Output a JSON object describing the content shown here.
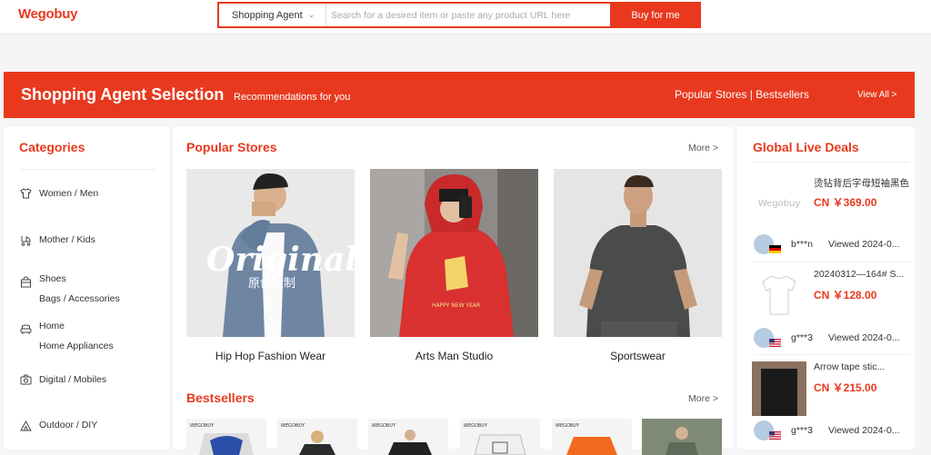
{
  "header": {
    "logo_text": "Wegobuy",
    "search": {
      "type_label": "Shopping Agent",
      "placeholder": "Search for a desired item or paste any product URL here",
      "button_label": "Buy for me"
    }
  },
  "banner": {
    "title": "Shopping Agent Selection",
    "subtitle": "Recommendations for you",
    "right_text": "Popular Stores | Bestsellers",
    "view_all": "View All >"
  },
  "categories": {
    "title": "Categories",
    "items": [
      {
        "lines": [
          "Women / Men"
        ],
        "icon": "shirt-icon"
      },
      {
        "lines": [
          "Mother / Kids"
        ],
        "icon": "stroller-icon"
      },
      {
        "lines": [
          "Shoes",
          "Bags / Accessories"
        ],
        "icon": "bag-icon"
      },
      {
        "lines": [
          "Home",
          "Home Appliances"
        ],
        "icon": "sofa-icon"
      },
      {
        "lines": [
          "Digital / Mobiles"
        ],
        "icon": "camera-icon"
      },
      {
        "lines": [
          "Outdoor / DIY"
        ],
        "icon": "tent-icon"
      }
    ]
  },
  "popular_stores": {
    "title": "Popular Stores",
    "more": "More >",
    "stores": [
      {
        "name": "Hip Hop Fashion Wear",
        "overlay": "Original",
        "overlay_sub": "原创定制"
      },
      {
        "name": "Arts Man Studio",
        "overlay": "HAPPY NEW YEAR"
      },
      {
        "name": "Sportswear"
      }
    ]
  },
  "bestsellers": {
    "title": "Bestsellers",
    "more": "More >",
    "brand_tag": "WEGOBUY"
  },
  "live_deals": {
    "title": "Global Live Deals",
    "products": [
      {
        "name": "烫钻背后字母短袖黑色",
        "price": "CN ￥369.00",
        "thumb": "Wegobuy"
      },
      {
        "name": "20240312—164# S...",
        "price": "CN ￥128.00"
      },
      {
        "name": "Arrow tape stic...",
        "price": "CN ￥215.00"
      }
    ],
    "viewers": [
      {
        "user": "b***n",
        "viewed": "Viewed 2024-0...",
        "flag": "DE"
      },
      {
        "user": "g***3",
        "viewed": "Viewed 2024-0...",
        "flag": "US"
      },
      {
        "user": "g***3",
        "viewed": "Viewed 2024-0...",
        "flag": "US"
      }
    ]
  },
  "colors": {
    "accent": "#e8391f",
    "background": "#f5f5f5"
  }
}
